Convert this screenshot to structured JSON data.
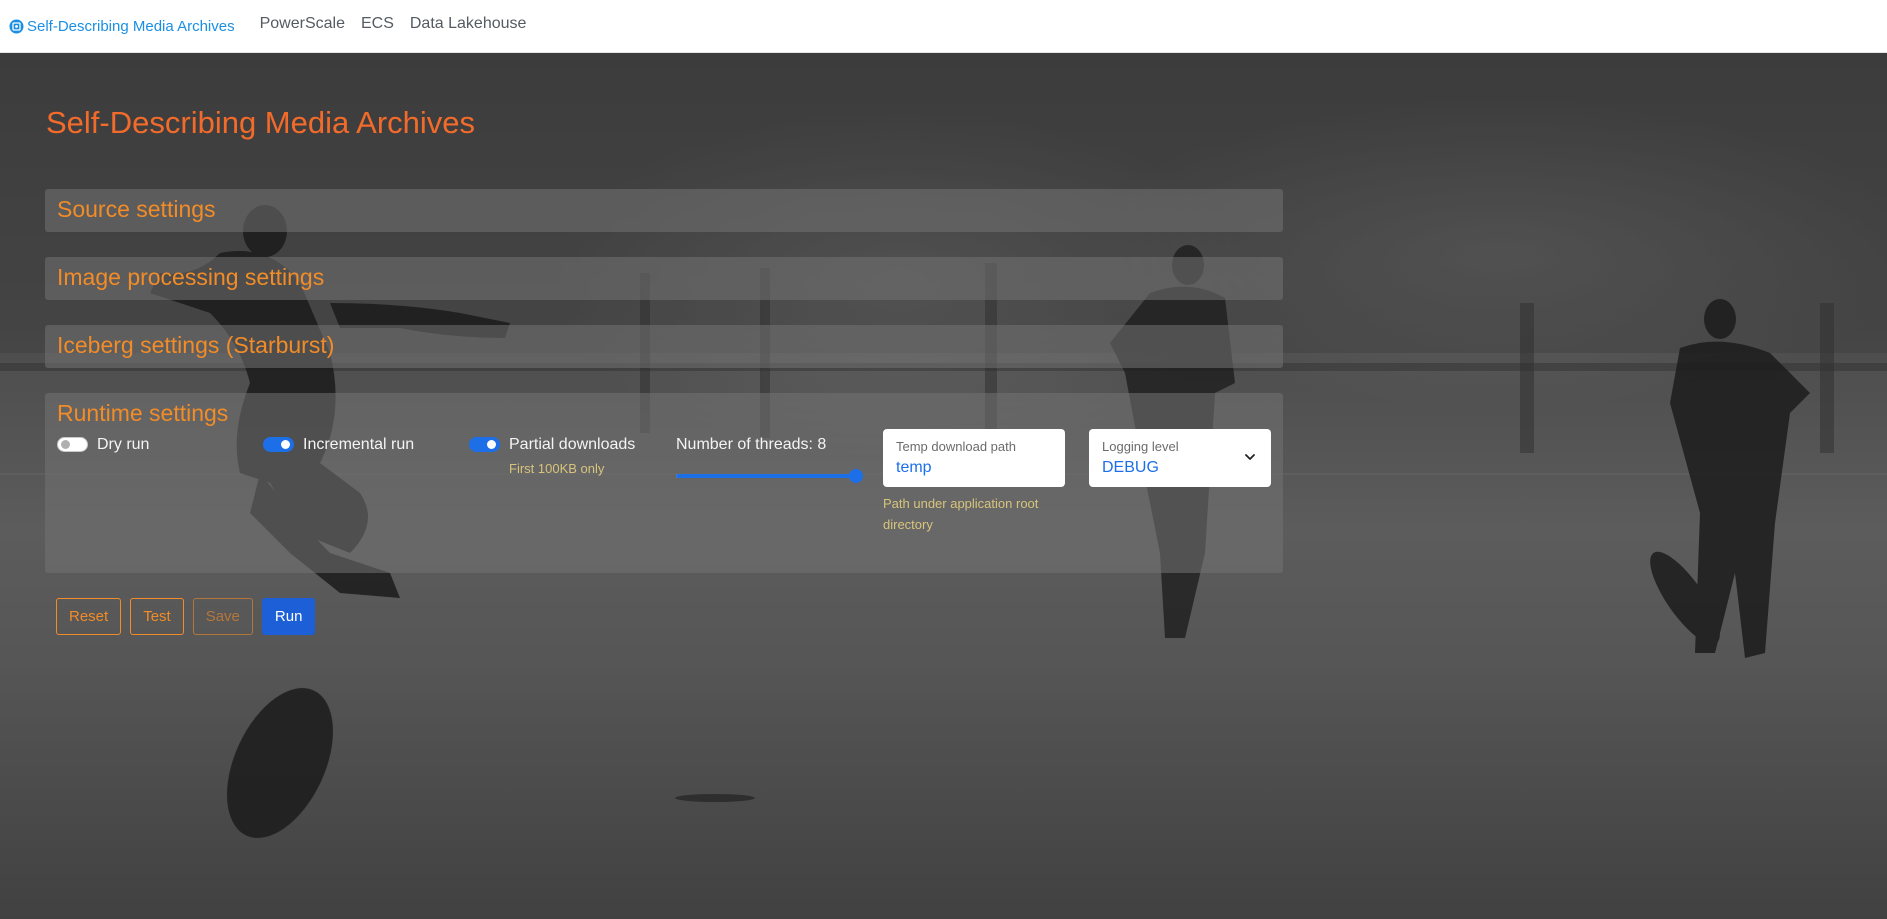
{
  "navbar": {
    "brand_label": "Self-Describing Media Archives",
    "links": [
      {
        "label": "PowerScale"
      },
      {
        "label": "ECS"
      },
      {
        "label": "Data Lakehouse"
      }
    ]
  },
  "page": {
    "title": "Self-Describing Media Archives"
  },
  "panels": [
    {
      "title": "Source settings",
      "expanded": false
    },
    {
      "title": "Image processing settings",
      "expanded": false
    },
    {
      "title": "Iceberg settings (Starburst)",
      "expanded": false
    },
    {
      "title": "Runtime settings",
      "expanded": true
    }
  ],
  "runtime": {
    "dry_run": {
      "label": "Dry run",
      "checked": false
    },
    "incremental_run": {
      "label": "Incremental run",
      "checked": true
    },
    "partial_downloads": {
      "label": "Partial downloads",
      "checked": true,
      "helper": "First 100KB only"
    },
    "threads": {
      "label": "Number of threads: 8",
      "value": 8,
      "fraction": 1.0
    },
    "temp_path": {
      "label": "Temp download path",
      "value": "temp",
      "helper": "Path under application root directory"
    },
    "logging": {
      "label": "Logging level",
      "value": "DEBUG"
    }
  },
  "buttons": {
    "reset": "Reset",
    "test": "Test",
    "save": "Save",
    "run": "Run"
  },
  "colors": {
    "accent_orange": "#f28c28",
    "title_orange": "#f26b2a",
    "primary_blue": "#1d6fe8",
    "brand_blue": "#1a8fe3",
    "helper_text": "#d8c47c"
  },
  "icons": {
    "brand": "circle-logo-icon",
    "logging_select": "chevron-down-icon"
  }
}
